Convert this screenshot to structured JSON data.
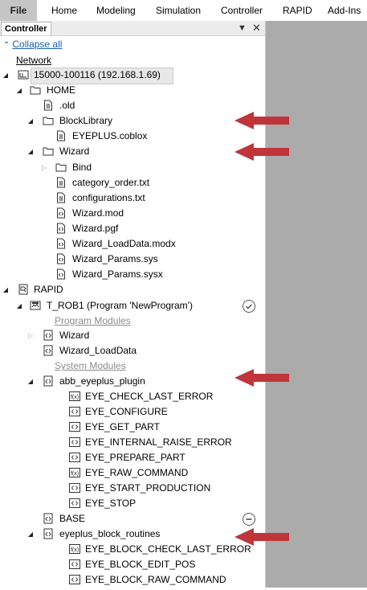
{
  "ribbon": {
    "tabs": [
      "File",
      "Home",
      "Modeling",
      "Simulation",
      "Controller",
      "RAPID",
      "Add-Ins"
    ]
  },
  "panel": {
    "title": "Controller",
    "collapse_all": "Collapse all"
  },
  "tree": [
    {
      "label": "Network",
      "style": "net"
    },
    {
      "label": "15000-100116 (192.168.1.69)",
      "icon": "controller-icon",
      "expander": "expanded"
    },
    {
      "label": "HOME",
      "icon": "folder-icon",
      "expander": "expanded"
    },
    {
      "label": ".old",
      "icon": "text-file-icon"
    },
    {
      "label": "BlockLibrary",
      "icon": "folder-icon",
      "expander": "expanded"
    },
    {
      "label": "EYEPLUS.coblox",
      "icon": "text-file-icon"
    },
    {
      "label": "Wizard",
      "icon": "folder-icon",
      "expander": "expanded"
    },
    {
      "label": "Bind",
      "icon": "folder-icon",
      "expander": "collapsed"
    },
    {
      "label": "category_order.txt",
      "icon": "text-file-icon"
    },
    {
      "label": "configurations.txt",
      "icon": "text-file-icon"
    },
    {
      "label": "Wizard.mod",
      "icon": "code-file-icon"
    },
    {
      "label": "Wizard.pgf",
      "icon": "code-file-icon"
    },
    {
      "label": "Wizard_LoadData.modx",
      "icon": "code-file-icon"
    },
    {
      "label": "Wizard_Params.sys",
      "icon": "code-file-icon"
    },
    {
      "label": "Wizard_Params.sysx",
      "icon": "code-file-icon"
    },
    {
      "label": "RAPID",
      "icon": "rapid-icon",
      "expander": "expanded"
    },
    {
      "label": "T_ROB1 (Program 'NewProgram')",
      "icon": "task-icon",
      "expander": "expanded",
      "status": "check-circle-icon"
    },
    {
      "label": "Program Modules",
      "style": "sect"
    },
    {
      "label": "Wizard",
      "icon": "module-icon",
      "expander": "collapsed"
    },
    {
      "label": "Wizard_LoadData",
      "icon": "module-icon"
    },
    {
      "label": "System Modules",
      "style": "sect"
    },
    {
      "label": "abb_eyeplus_plugin",
      "icon": "module-icon",
      "expander": "expanded"
    },
    {
      "label": "EYE_CHECK_LAST_ERROR",
      "icon": "function-icon"
    },
    {
      "label": "EYE_CONFIGURE",
      "icon": "procedure-icon"
    },
    {
      "label": "EYE_GET_PART",
      "icon": "procedure-icon"
    },
    {
      "label": "EYE_INTERNAL_RAISE_ERROR",
      "icon": "procedure-icon"
    },
    {
      "label": "EYE_PREPARE_PART",
      "icon": "procedure-icon"
    },
    {
      "label": "EYE_RAW_COMMAND",
      "icon": "function-icon"
    },
    {
      "label": "EYE_START_PRODUCTION",
      "icon": "procedure-icon"
    },
    {
      "label": "EYE_STOP",
      "icon": "procedure-icon"
    },
    {
      "label": "BASE",
      "icon": "module-icon",
      "status": "minus-circle-icon"
    },
    {
      "label": "eyeplus_block_routines",
      "icon": "module-icon",
      "expander": "expanded"
    },
    {
      "label": "EYE_BLOCK_CHECK_LAST_ERROR",
      "icon": "function-icon"
    },
    {
      "label": "EYE_BLOCK_EDIT_POS",
      "icon": "procedure-icon"
    },
    {
      "label": "EYE_BLOCK_RAW_COMMAND",
      "icon": "procedure-icon"
    }
  ],
  "colors": {
    "arrow": "#c0353a",
    "file_tab": "#c5c5c5",
    "link": "#1a5fb4",
    "document_area": "#ababab"
  }
}
